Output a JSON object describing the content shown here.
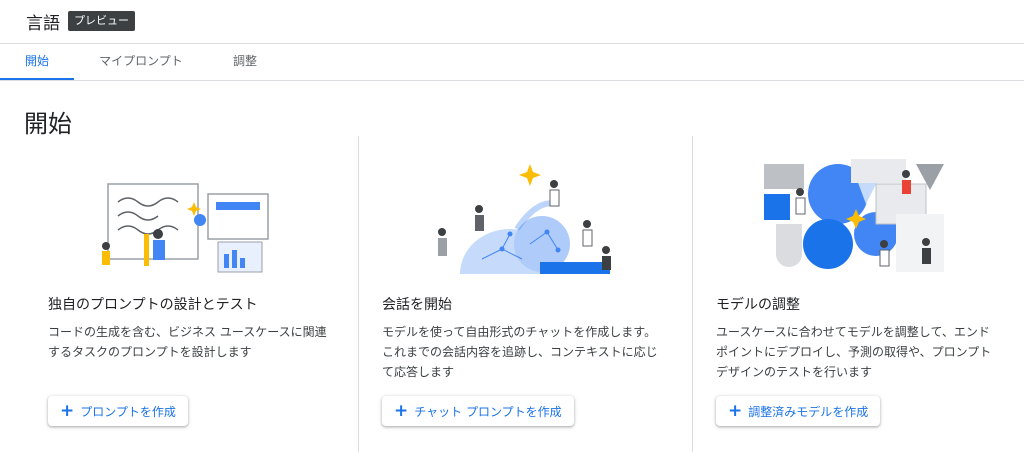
{
  "header": {
    "title": "言語",
    "badge": "プレビュー"
  },
  "tabs": [
    {
      "label": "開始",
      "active": true
    },
    {
      "label": "マイプロンプト",
      "active": false
    },
    {
      "label": "調整",
      "active": false
    }
  ],
  "page": {
    "title": "開始"
  },
  "cards": [
    {
      "title": "独自のプロンプトの設計とテスト",
      "description": "コードの生成を含む、ビジネス ユースケースに関連するタスクのプロンプトを設計します",
      "button": "プロンプトを作成",
      "button_icon": "plus-icon"
    },
    {
      "title": "会話を開始",
      "description": "モデルを使って自由形式のチャットを作成します。これまでの会話内容を追跡し、コンテキストに応じて応答します",
      "button": "チャット プロンプトを作成",
      "button_icon": "plus-icon"
    },
    {
      "title": "モデルの調整",
      "description": "ユースケースに合わせてモデルを調整して、エンドポイントにデプロイし、予測の取得や、プロンプト デザインのテストを行います",
      "button": "調整済みモデルを作成",
      "button_icon": "plus-icon"
    }
  ],
  "colors": {
    "accent": "#1a73e8",
    "badge_bg": "#3c4043",
    "divider": "#dadce0",
    "illustration_blue": "#4285f4"
  }
}
